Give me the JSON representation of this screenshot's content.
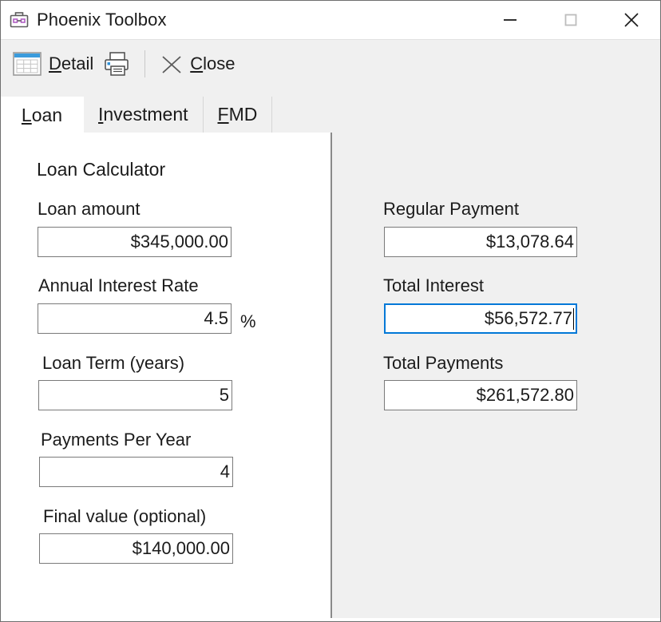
{
  "window": {
    "title": "Phoenix Toolbox",
    "app_icon": "briefcase-toolbox-icon",
    "controls": {
      "minimize": "minimize-icon",
      "maximize": "maximize-icon",
      "close": "close-icon"
    }
  },
  "toolbar": {
    "detail": {
      "label_prefix": "",
      "accel": "D",
      "label_rest": "etail",
      "icon": "grid-table-icon"
    },
    "print": {
      "icon": "printer-icon"
    },
    "close": {
      "accel": "C",
      "label_rest": "lose",
      "icon": "x-close-icon"
    }
  },
  "tabs": [
    {
      "accel": "L",
      "rest": "oan",
      "active": true
    },
    {
      "accel": "I",
      "rest": "nvestment",
      "active": false
    },
    {
      "accel": "F",
      "rest": "MD",
      "active": false
    }
  ],
  "left_panel": {
    "heading": "Loan Calculator",
    "fields": [
      {
        "label": "Loan amount",
        "value": "$345,000.00",
        "suffix": ""
      },
      {
        "label": "Annual Interest Rate",
        "value": "4.5",
        "suffix": "%"
      },
      {
        "label": "Loan Term (years)",
        "value": "5",
        "suffix": ""
      },
      {
        "label": "Payments Per Year",
        "value": "4",
        "suffix": ""
      },
      {
        "label": "Final value (optional)",
        "value": "$140,000.00",
        "suffix": ""
      }
    ]
  },
  "right_panel": {
    "fields": [
      {
        "label": "Regular Payment",
        "value": "$13,078.64",
        "focused": false
      },
      {
        "label": "Total Interest",
        "value": "$56,572.77",
        "focused": true
      },
      {
        "label": "Total Payments",
        "value": "$261,572.80",
        "focused": false
      }
    ]
  },
  "colors": {
    "accent_focus": "#0078d7",
    "toolbar_bg": "#f0f0f0",
    "panel_bg": "#f0f0f0",
    "text": "#1b1b1b"
  }
}
